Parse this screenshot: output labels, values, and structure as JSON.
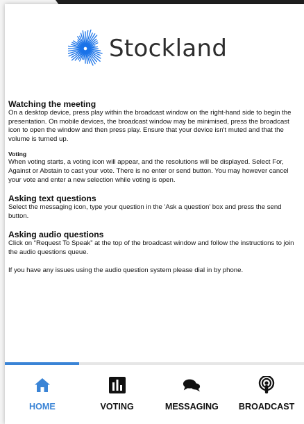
{
  "brand": {
    "name": "Stockland",
    "logo_color": "#1a73e8"
  },
  "sections": {
    "watching": {
      "title": "Watching the meeting",
      "body": "On a desktop device, press play within the broadcast window on the right-hand side to begin the presentation. On mobile devices, the broadcast window may be minimised, press the broadcast icon to open the window and then press play. Ensure that your device isn't muted and that the volume is turned up."
    },
    "voting": {
      "title": "Voting",
      "body": "When voting starts, a voting icon will appear, and the resolutions will be displayed. Select For, Against or Abstain to cast your vote. There is no enter or send button. You may however cancel your vote and enter a new selection while voting is open."
    },
    "text_questions": {
      "title": "Asking text questions",
      "body": "Select the messaging icon, type your question in the 'Ask a question' box and press the send button."
    },
    "audio_questions": {
      "title": "Asking audio questions",
      "body": "Click on “Request To Speak” at the top of the broadcast window and follow the instructions to join the audio questions queue.",
      "note": "If you have any issues using the audio question system please dial in by phone."
    }
  },
  "tabs": {
    "home": {
      "label": "HOME",
      "icon": "home-icon",
      "active": true
    },
    "voting": {
      "label": "VOTING",
      "icon": "bar-chart-icon",
      "active": false
    },
    "messaging": {
      "label": "MESSAGING",
      "icon": "chat-bubbles-icon",
      "active": false
    },
    "broadcast": {
      "label": "BROADCAST",
      "icon": "podcast-icon",
      "active": false
    }
  },
  "colors": {
    "accent": "#3a84d6",
    "header_band": "#1f1f1f",
    "text": "#111111"
  }
}
